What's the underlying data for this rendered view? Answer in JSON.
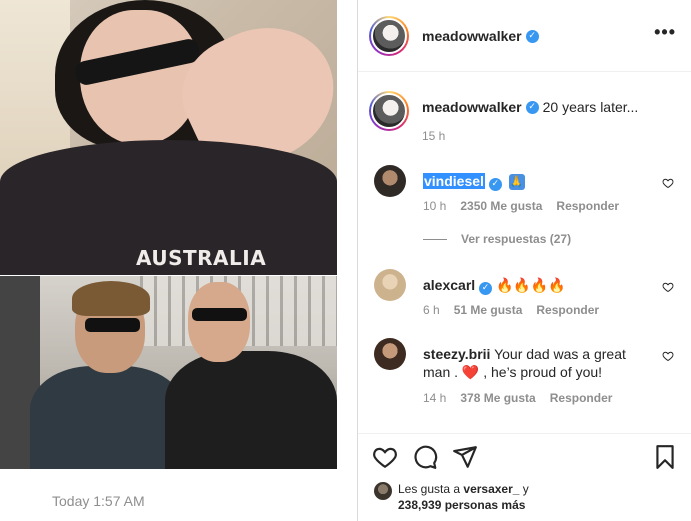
{
  "media": {
    "shirt_text": "AUSTRALIA",
    "timestamp": "Today 1:57 AM"
  },
  "post": {
    "author": "meadowwalker",
    "more_label": "•••"
  },
  "caption": {
    "user": "meadowwalker",
    "text": "20 years later...",
    "time": "15 h"
  },
  "comments": [
    {
      "user": "vindiesel",
      "text": "🙏",
      "time": "10 h",
      "likes": "2350 Me gusta",
      "reply": "Responder",
      "view_replies": "Ver respuestas (27)"
    },
    {
      "user": "alexcarl",
      "text": "🔥🔥🔥🔥",
      "time": "6 h",
      "likes": "51 Me gusta",
      "reply": "Responder"
    },
    {
      "user": "steezy.brii",
      "text_before": "Your dad was a great man . ",
      "text_heart": "❤️",
      "text_after": " , he’s proud of you!",
      "time": "14 h",
      "likes": "378 Me gusta",
      "reply": "Responder"
    }
  ],
  "likes": {
    "prefix": "Les gusta a",
    "user": "versaxer_",
    "joiner": "y",
    "count": "238,939 personas más"
  },
  "icons": {
    "verified": "✓",
    "heart_outline": "heart-outline-icon",
    "comment": "comment-icon",
    "share": "share-icon",
    "bookmark": "bookmark-icon"
  },
  "colors": {
    "verified_blue": "#3897f0",
    "selection_blue": "#3390ff",
    "muted_text": "#8e8e8e"
  }
}
